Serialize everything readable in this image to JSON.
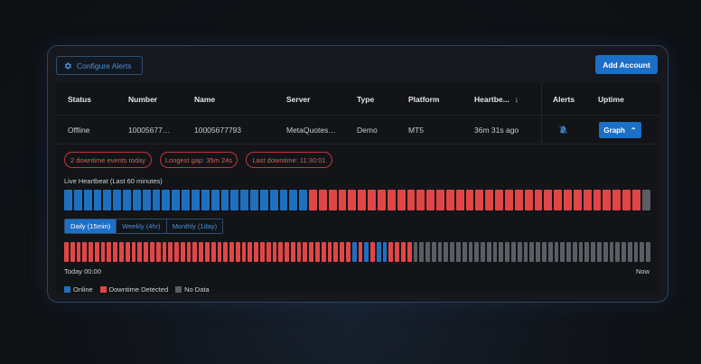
{
  "header": {
    "configure_label": "Configure Alerts",
    "add_account_label": "Add Account"
  },
  "table": {
    "columns": [
      "Status",
      "Number",
      "Name",
      "Server",
      "Type",
      "Platform",
      "Heartbe...",
      "Alerts",
      "Uptime"
    ],
    "row": {
      "status": "Offline",
      "number": "10005677…",
      "name": "10005677793",
      "server": "MetaQuotes…",
      "type": "Demo",
      "platform": "MT5",
      "heartbeat": "36m 31s ago",
      "uptime_button": "Graph"
    }
  },
  "stats": {
    "events": "2 downtime events today",
    "gap": "Longest gap: 35m 24s",
    "last": "Last downtime: 11:30:01"
  },
  "live": {
    "title": "Live Heartbeat (Last 60 minutes)",
    "bars": [
      "o",
      "o",
      "o",
      "o",
      "o",
      "o",
      "o",
      "o",
      "o",
      "o",
      "o",
      "o",
      "o",
      "o",
      "o",
      "o",
      "o",
      "o",
      "o",
      "o",
      "o",
      "o",
      "o",
      "o",
      "o",
      "d",
      "d",
      "d",
      "d",
      "d",
      "d",
      "d",
      "d",
      "d",
      "d",
      "d",
      "d",
      "d",
      "d",
      "d",
      "d",
      "d",
      "d",
      "d",
      "d",
      "d",
      "d",
      "d",
      "d",
      "d",
      "d",
      "d",
      "d",
      "d",
      "d",
      "d",
      "d",
      "d",
      "d",
      "n"
    ]
  },
  "history": {
    "tabs": [
      "Daily (15min)",
      "Weekly (4hr)",
      "Monthly (1day)"
    ],
    "active_tab": 0,
    "bars": [
      "d",
      "d",
      "d",
      "d",
      "d",
      "d",
      "d",
      "d",
      "d",
      "d",
      "d",
      "d",
      "d",
      "d",
      "d",
      "d",
      "d",
      "d",
      "d",
      "d",
      "d",
      "d",
      "d",
      "d",
      "d",
      "d",
      "d",
      "d",
      "d",
      "d",
      "d",
      "d",
      "d",
      "d",
      "d",
      "d",
      "d",
      "d",
      "d",
      "d",
      "d",
      "d",
      "d",
      "d",
      "d",
      "d",
      "d",
      "o",
      "d",
      "o",
      "d",
      "o",
      "o",
      "d",
      "d",
      "d",
      "d",
      "n",
      "n",
      "n",
      "n",
      "n",
      "n",
      "n",
      "n",
      "n",
      "n",
      "n",
      "n",
      "n",
      "n",
      "n",
      "n",
      "n",
      "n",
      "n",
      "n",
      "n",
      "n",
      "n",
      "n",
      "n",
      "n",
      "n",
      "n",
      "n",
      "n",
      "n",
      "n",
      "n",
      "n",
      "n",
      "n",
      "n",
      "n",
      "n"
    ],
    "start_label": "Today 00:00",
    "end_label": "Now"
  },
  "legend": {
    "online": "Online",
    "downtime": "Downtime Detected",
    "nodata": "No Data"
  },
  "colors": {
    "online": "#1f6fbf",
    "downtime": "#e04646",
    "nodata": "#5a5d63",
    "accent": "#1c6fc6"
  }
}
